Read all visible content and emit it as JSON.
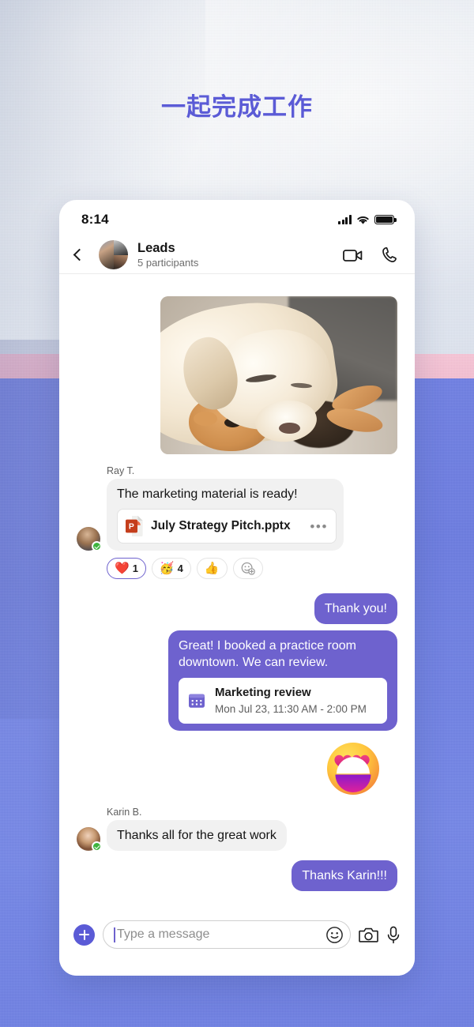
{
  "headline": "一起完成工作",
  "colors": {
    "accent_purple": "#6e62ce",
    "headline_purple": "#5b5bd6",
    "plus_button": "#5b5bd6",
    "bg_pink_band": "#f3bfd2",
    "bg_blue": "#6f7fe3",
    "presence_green": "#3db43d",
    "incoming_bubble": "#f1f1f1"
  },
  "status_bar": {
    "time": "8:14",
    "signal_icon": "cellular-bars-icon",
    "wifi_icon": "wifi-icon",
    "battery_icon": "battery-full-icon"
  },
  "chat_header": {
    "back_icon": "back-chevron-icon",
    "avatar": "group-avatar",
    "title": "Leads",
    "subtitle": "5 participants",
    "video_icon": "video-call-icon",
    "call_icon": "phone-call-icon"
  },
  "thread": {
    "photo_message": {
      "alt": "sleeping-labrador-with-plush-toy"
    },
    "ray_message": {
      "sender": "Ray T.",
      "avatar": "ray-avatar",
      "presence": "available",
      "text": "The marketing material is ready!",
      "file": {
        "icon": "powerpoint-file-icon",
        "name": "July Strategy Pitch.pptx",
        "more_label": "•••"
      }
    },
    "reactions": [
      {
        "icon": "heart-reaction-icon",
        "emoji": "❤️",
        "count": "1",
        "selected": true
      },
      {
        "icon": "party-face-reaction-icon",
        "emoji": "🥳",
        "count": "4",
        "selected": false
      },
      {
        "icon": "thumbs-up-reaction-icon",
        "emoji": "👍",
        "count": "",
        "selected": false
      },
      {
        "icon": "add-reaction-icon",
        "emoji": "",
        "count": "",
        "selected": false
      }
    ],
    "thank_you": "Thank you!",
    "booking_message": {
      "text": "Great! I booked a practice room downtown. We can review.",
      "event": {
        "icon": "calendar-icon",
        "title": "Marketing review",
        "time": "Mon Jul 23, 11:30 AM - 2:00 PM"
      }
    },
    "sticker": {
      "icon": "heart-eyes-emoji-sticker",
      "label": "😍"
    },
    "karin_message": {
      "sender": "Karin B.",
      "avatar": "karin-avatar",
      "presence": "available",
      "text": "Thanks all for the great work"
    },
    "thanks_karin": "Thanks Karin!!!"
  },
  "composer": {
    "plus_icon": "add-attachment-icon",
    "input_value": "",
    "input_placeholder": "Type a message",
    "emoji_icon": "emoji-picker-icon",
    "camera_icon": "camera-icon",
    "mic_icon": "microphone-icon"
  }
}
